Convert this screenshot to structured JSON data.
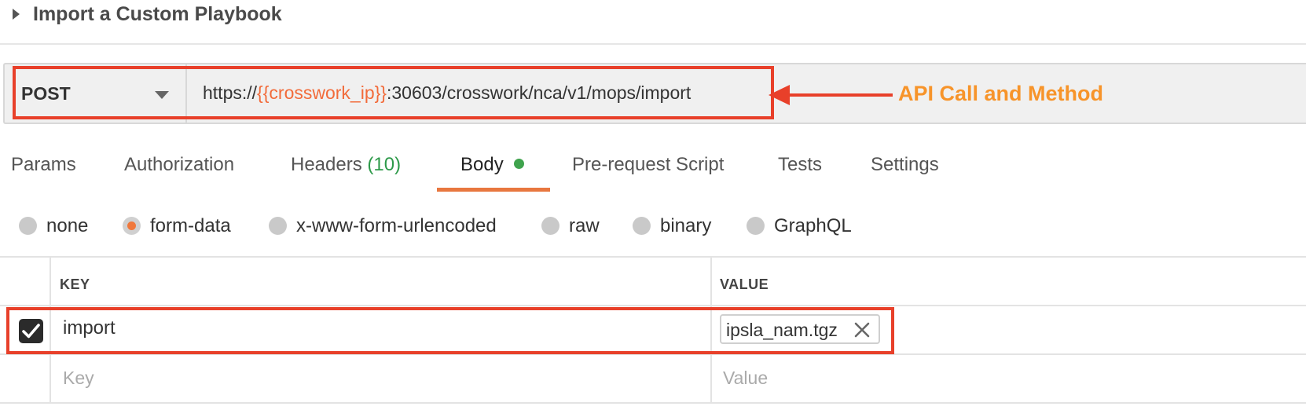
{
  "section": {
    "title": "Import a Custom Playbook"
  },
  "request": {
    "method": "POST",
    "url_prefix": "https://",
    "url_variable": "{{crosswork_ip}}",
    "url_suffix": ":30603/crosswork/nca/v1/mops/import"
  },
  "annotation": {
    "text": "API Call and Method"
  },
  "tabs": [
    {
      "label": "Params"
    },
    {
      "label": "Authorization"
    },
    {
      "label": "Headers",
      "count": "(10)"
    },
    {
      "label": "Body"
    },
    {
      "label": "Pre-request Script"
    },
    {
      "label": "Tests"
    },
    {
      "label": "Settings"
    }
  ],
  "body_types": [
    {
      "label": "none"
    },
    {
      "label": "form-data"
    },
    {
      "label": "x-www-form-urlencoded"
    },
    {
      "label": "raw"
    },
    {
      "label": "binary"
    },
    {
      "label": "GraphQL"
    }
  ],
  "table": {
    "headers": {
      "key": "KEY",
      "value": "VALUE"
    },
    "row": {
      "key": "import",
      "file": "ipsla_nam.tgz"
    },
    "placeholder": {
      "key": "Key",
      "value": "Value"
    }
  },
  "colors": {
    "accent": "#f0783c",
    "annotation_red": "#e8402a",
    "annotation_text": "#f7942a",
    "status_green": "#3fa34d"
  },
  "icons": {
    "collapse": "caret-right-icon",
    "dropdown": "chevron-down-icon",
    "check": "check-icon",
    "remove": "close-icon",
    "status": "status-dot-icon"
  }
}
